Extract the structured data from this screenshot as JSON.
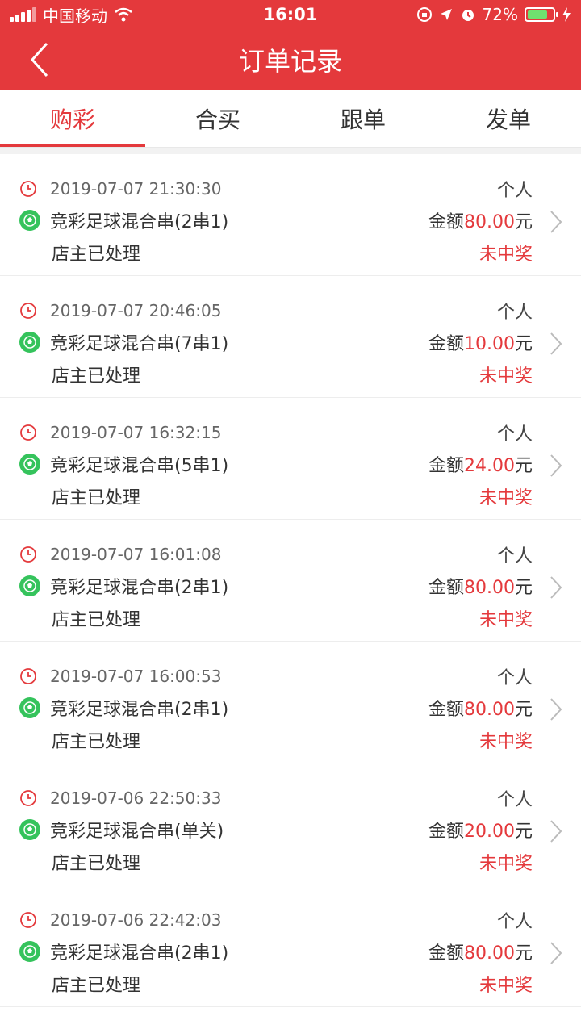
{
  "status_bar": {
    "carrier": "中国移动",
    "time": "16:01",
    "battery": "72%"
  },
  "header": {
    "title": "订单记录"
  },
  "tabs": [
    {
      "label": "购彩",
      "active": true
    },
    {
      "label": "合买",
      "active": false
    },
    {
      "label": "跟单",
      "active": false
    },
    {
      "label": "发单",
      "active": false
    }
  ],
  "orders": [
    {
      "datetime": "2019-07-07 21:30:30",
      "type": "个人",
      "name": "竞彩足球混合串(2串1)",
      "amount_label": "金额",
      "amount": "80.00",
      "unit": "元",
      "processing": "店主已处理",
      "result": "未中奖"
    },
    {
      "datetime": "2019-07-07 20:46:05",
      "type": "个人",
      "name": "竞彩足球混合串(7串1)",
      "amount_label": "金额",
      "amount": "10.00",
      "unit": "元",
      "processing": "店主已处理",
      "result": "未中奖"
    },
    {
      "datetime": "2019-07-07 16:32:15",
      "type": "个人",
      "name": "竞彩足球混合串(5串1)",
      "amount_label": "金额",
      "amount": "24.00",
      "unit": "元",
      "processing": "店主已处理",
      "result": "未中奖"
    },
    {
      "datetime": "2019-07-07 16:01:08",
      "type": "个人",
      "name": "竞彩足球混合串(2串1)",
      "amount_label": "金额",
      "amount": "80.00",
      "unit": "元",
      "processing": "店主已处理",
      "result": "未中奖"
    },
    {
      "datetime": "2019-07-07 16:00:53",
      "type": "个人",
      "name": "竞彩足球混合串(2串1)",
      "amount_label": "金额",
      "amount": "80.00",
      "unit": "元",
      "processing": "店主已处理",
      "result": "未中奖"
    },
    {
      "datetime": "2019-07-06 22:50:33",
      "type": "个人",
      "name": "竞彩足球混合串(单关)",
      "amount_label": "金额",
      "amount": "20.00",
      "unit": "元",
      "processing": "店主已处理",
      "result": "未中奖"
    },
    {
      "datetime": "2019-07-06 22:42:03",
      "type": "个人",
      "name": "竞彩足球混合串(2串1)",
      "amount_label": "金额",
      "amount": "80.00",
      "unit": "元",
      "processing": "店主已处理",
      "result": "未中奖"
    }
  ],
  "colors": {
    "brand": "#e4393c",
    "ball": "#35c35c"
  },
  "icons": {
    "back": "chevron-left-icon",
    "clock": "clock-icon",
    "ball": "soccer-ball-icon",
    "chevron": "chevron-right-icon"
  }
}
